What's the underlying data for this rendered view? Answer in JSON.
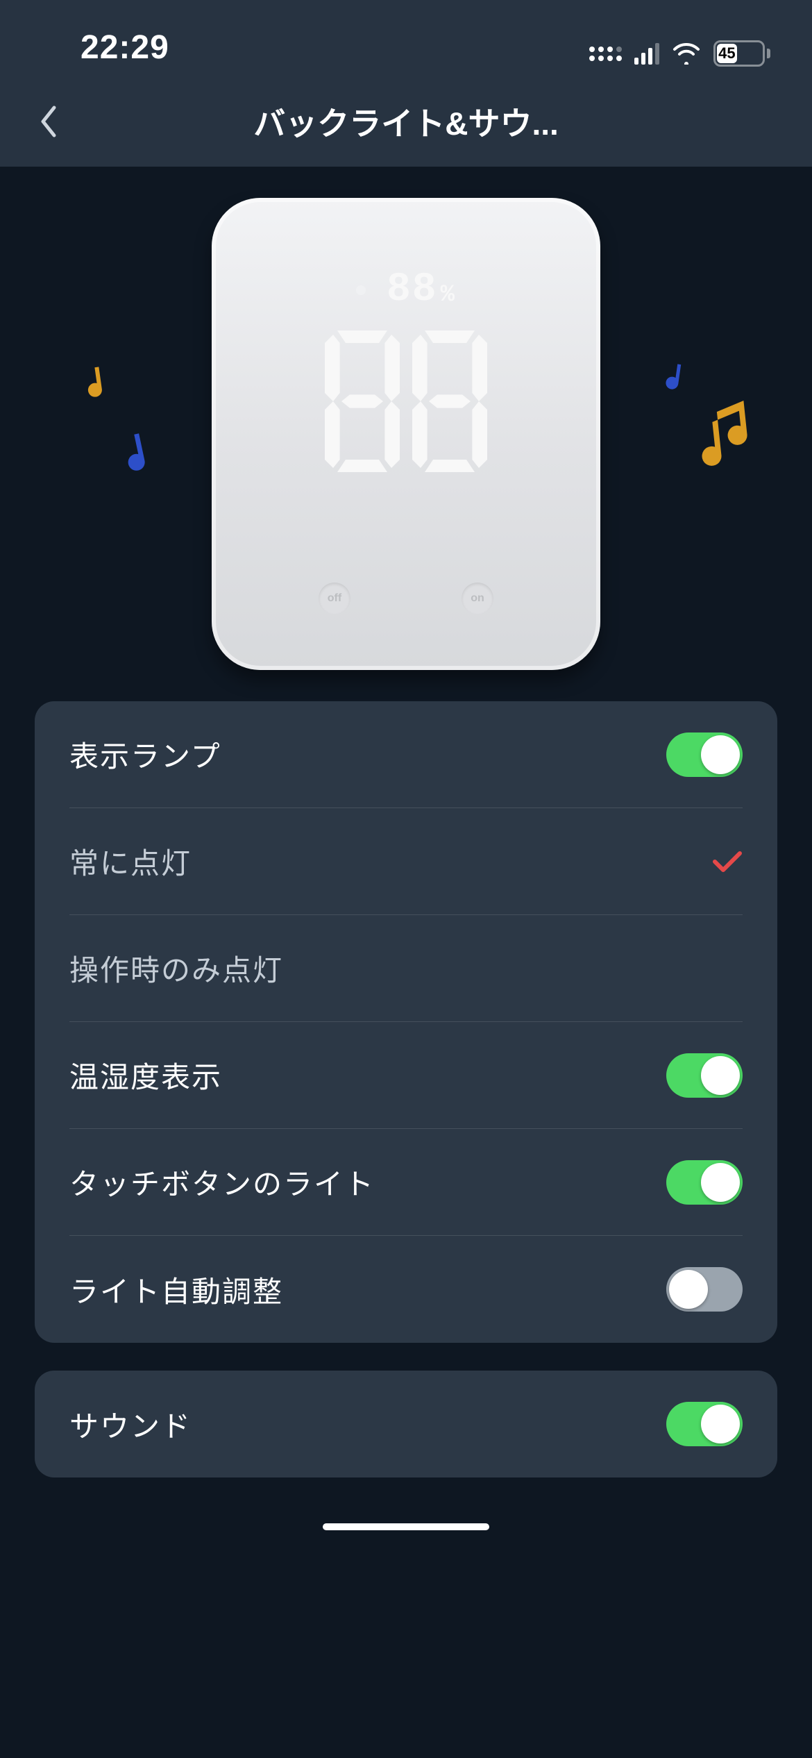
{
  "status": {
    "time": "22:29",
    "battery": "45"
  },
  "nav": {
    "title": "バックライト&サウ..."
  },
  "device": {
    "humidity": "88",
    "humidity_unit": "%",
    "temp_digit1": "8",
    "temp_digit2": "8",
    "off_label": "off",
    "on_label": "on"
  },
  "settings": {
    "indicator_lamp": {
      "label": "表示ランプ",
      "value": true
    },
    "always_on": {
      "label": "常に点灯",
      "selected": true
    },
    "on_operation": {
      "label": "操作時のみ点灯",
      "selected": false
    },
    "temp_humidity": {
      "label": "温湿度表示",
      "value": true
    },
    "touch_light": {
      "label": "タッチボタンのライト",
      "value": true
    },
    "auto_brightness": {
      "label": "ライト自動調整",
      "value": false
    }
  },
  "sound": {
    "label": "サウンド",
    "value": true
  }
}
